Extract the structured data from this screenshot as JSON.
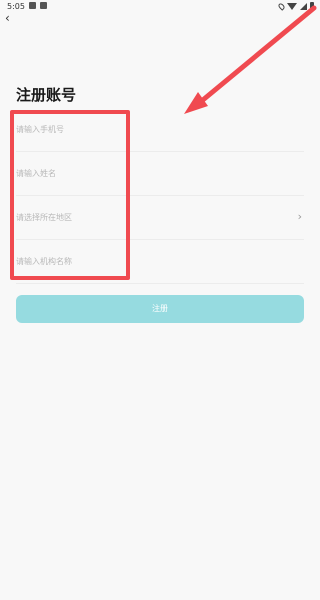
{
  "status_bar": {
    "time": "5:05"
  },
  "navigation": {
    "back_icon": "chevron-left-icon",
    "back_glyph": "‹"
  },
  "page": {
    "title": "注册账号"
  },
  "form": {
    "phone_placeholder": "请输入手机号",
    "name_placeholder": "请输入姓名",
    "region_placeholder": "请选择所在地区",
    "region_icon": "chevron-right-icon",
    "region_glyph": "›",
    "org_placeholder": "请输入机构名称"
  },
  "submit": {
    "label": "注册",
    "color": "#96dbe0"
  },
  "annotation": {
    "color": "#f04a50"
  }
}
